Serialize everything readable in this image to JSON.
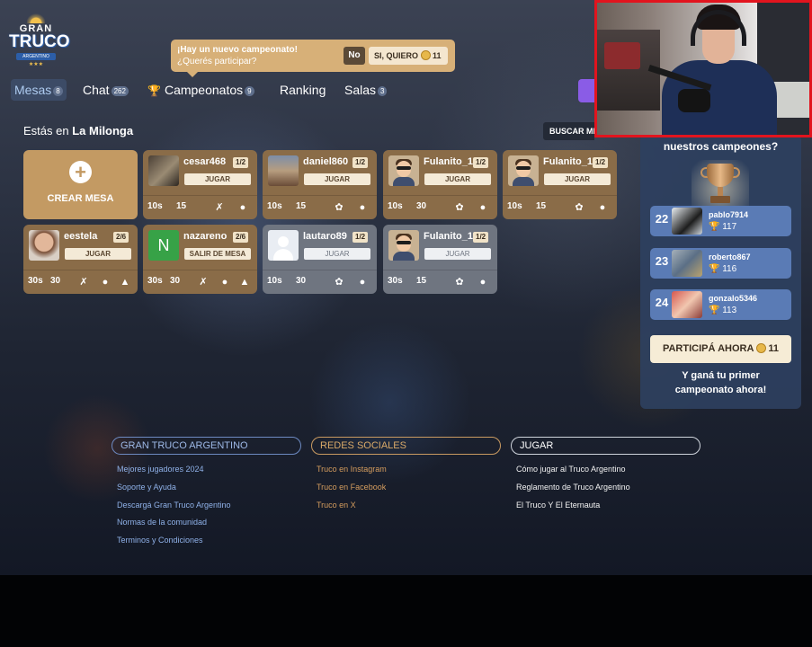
{
  "logo": {
    "line1": "GRAN",
    "line2": "TRUCO",
    "line3": "ARGENTINO",
    "stars": "★★★"
  },
  "banner": {
    "title": "¡Hay un nuevo campeonato!",
    "subtitle": "¿Querés participar?",
    "no_label": "No",
    "yes_label": "SI, QUIERO",
    "yes_coins": "11"
  },
  "nav": {
    "mesas": {
      "label": "Mesas",
      "badge": "8"
    },
    "chat": {
      "label": "Chat",
      "badge": "262"
    },
    "campeonatos": {
      "label": "Campeonatos",
      "badge": "9"
    },
    "ranking": {
      "label": "Ranking"
    },
    "salas": {
      "label": "Salas",
      "badge": "3"
    }
  },
  "location": {
    "prefix": "Estás en",
    "room": "La Milonga"
  },
  "search_label": "BUSCAR MESA",
  "create_label": "CREAR MESA",
  "tables": [
    {
      "name": "cesar468",
      "count": "1/2",
      "button": "JUGAR",
      "time": "10s",
      "points": "15"
    },
    {
      "name": "daniel860",
      "count": "1/2",
      "button": "JUGAR",
      "time": "10s",
      "points": "15"
    },
    {
      "name": "Fulanito_1",
      "count": "1/2",
      "button": "JUGAR",
      "time": "10s",
      "points": "30"
    },
    {
      "name": "Fulanito_1",
      "count": "1/2",
      "button": "JUGAR",
      "time": "10s",
      "points": "15"
    },
    {
      "name": "eestela",
      "count": "2/6",
      "button": "JUGAR",
      "time": "30s",
      "points": "30"
    },
    {
      "name": "nazareno",
      "count": "2/6",
      "button": "SALIR DE MESA",
      "time": "30s",
      "points": "30",
      "initial": "N"
    },
    {
      "name": "lautaro89",
      "count": "1/2",
      "button": "JUGAR",
      "time": "10s",
      "points": "30"
    },
    {
      "name": "Fulanito_1",
      "count": "1/2",
      "button": "JUGAR",
      "time": "30s",
      "points": "15"
    }
  ],
  "panel": {
    "title": "nuestros campeones?",
    "champions": [
      {
        "rank": "22",
        "name": "pablo7914",
        "points": "117"
      },
      {
        "rank": "23",
        "name": "roberto867",
        "points": "116"
      },
      {
        "rank": "24",
        "name": "gonzalo5346",
        "points": "113"
      }
    ],
    "participa_label": "PARTICIPÁ AHORA",
    "participa_coins": "11",
    "promo_line1": "Y ganá tu primer",
    "promo_line2": "campeonato ahora!"
  },
  "footer": {
    "col1": {
      "title": "GRAN TRUCO ARGENTINO",
      "links": [
        "Mejores jugadores 2024",
        "Soporte y Ayuda",
        "Descargá Gran Truco Argentino",
        "Normas de la comunidad",
        "Terminos y Condiciones"
      ]
    },
    "col2": {
      "title": "REDES SOCIALES",
      "links": [
        "Truco en Instagram",
        "Truco en Facebook",
        "Truco en X"
      ]
    },
    "col3": {
      "title": "JUGAR",
      "links": [
        "Cómo jugar al Truco Argentino",
        "Reglamento de Truco Argentino",
        "El Truco Y El Eternauta"
      ]
    }
  },
  "colors": {
    "accent_gold": "#c39a63",
    "table_brown": "#8a6c48",
    "table_gray": "#6f7580",
    "panel_blue": "#2e4060",
    "champ_blue": "#5a7bb5",
    "webcam_border": "#e2141e"
  },
  "icons": [
    "sun-icon",
    "coin-icon",
    "trophy-icon",
    "plus-icon",
    "boot-icon",
    "chat-bubble-icon",
    "no-flor-icon",
    "flower-icon",
    "default-avatar-icon"
  ]
}
